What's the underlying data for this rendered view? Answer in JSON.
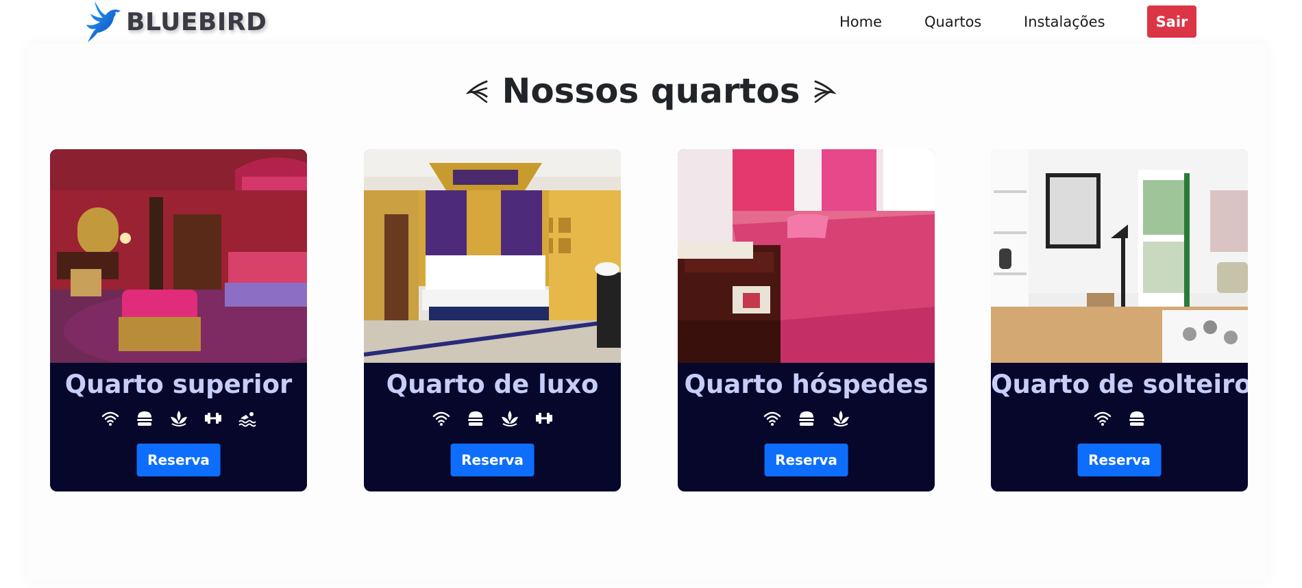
{
  "brand": {
    "name": "BLUEBIRD",
    "logo_icon": "bird-logo-icon",
    "color": "#1677e6"
  },
  "nav": {
    "home": "Home",
    "rooms": "Quartos",
    "facilities": "Instalações",
    "logout": "Sair",
    "logout_color": "#dc3545"
  },
  "section": {
    "title": "Nossos quartos"
  },
  "rooms": [
    {
      "title": "Quarto superior",
      "amenities": [
        "wifi-icon",
        "burger-icon",
        "spa-icon",
        "dumbbell-icon",
        "swimming-icon"
      ],
      "button": "Reserva"
    },
    {
      "title": "Quarto de luxo",
      "amenities": [
        "wifi-icon",
        "burger-icon",
        "spa-icon",
        "dumbbell-icon"
      ],
      "button": "Reserva"
    },
    {
      "title": "Quarto hóspedes",
      "amenities": [
        "wifi-icon",
        "burger-icon",
        "spa-icon"
      ],
      "button": "Reserva"
    },
    {
      "title": "Quarto de solteiro",
      "amenities": [
        "wifi-icon",
        "burger-icon"
      ],
      "button": "Reserva"
    }
  ],
  "colors": {
    "card_bg": "#07072b",
    "card_title": "#c5cdf8",
    "button": "#0d6efd"
  }
}
